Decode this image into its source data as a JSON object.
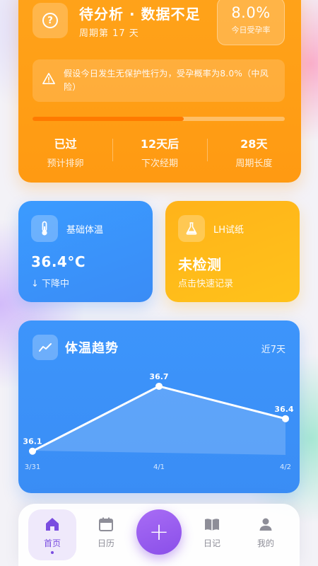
{
  "status": {
    "title": "待分析 · 数据不足",
    "cycle_day": "周期第 17 天",
    "probability_value": "8.0%",
    "probability_label": "今日受孕率",
    "warning": "假设今日发生无保护性行为，受孕概率为8.0%（中风险）",
    "progress_fraction": 0.6,
    "stats": [
      {
        "value": "已过",
        "label": "预计排卵"
      },
      {
        "value": "12天后",
        "label": "下次经期"
      },
      {
        "value": "28天",
        "label": "周期长度"
      }
    ]
  },
  "bbt": {
    "title": "基础体温",
    "value": "36.4°C",
    "trend": "↓ 下降中"
  },
  "lh": {
    "title": "LH试纸",
    "value": "未检测",
    "hint": "点击快速记录"
  },
  "trend": {
    "title": "体温趋势",
    "range_label": "近7天"
  },
  "chart_data": {
    "type": "line",
    "categories": [
      "3/31",
      "4/1",
      "4/2"
    ],
    "values": [
      36.1,
      36.7,
      36.4
    ],
    "data_labels": [
      "36.1",
      "36.7",
      "36.4"
    ],
    "ylim": [
      36.0,
      36.85
    ]
  },
  "nav": {
    "home": "首页",
    "calendar": "日历",
    "add": "+",
    "diary": "日记",
    "profile": "我的"
  },
  "colors": {
    "orange": "#ff9f17",
    "blue": "#3a8ef6",
    "yellow": "#ffbb1a",
    "purple": "#8a4fe9"
  }
}
